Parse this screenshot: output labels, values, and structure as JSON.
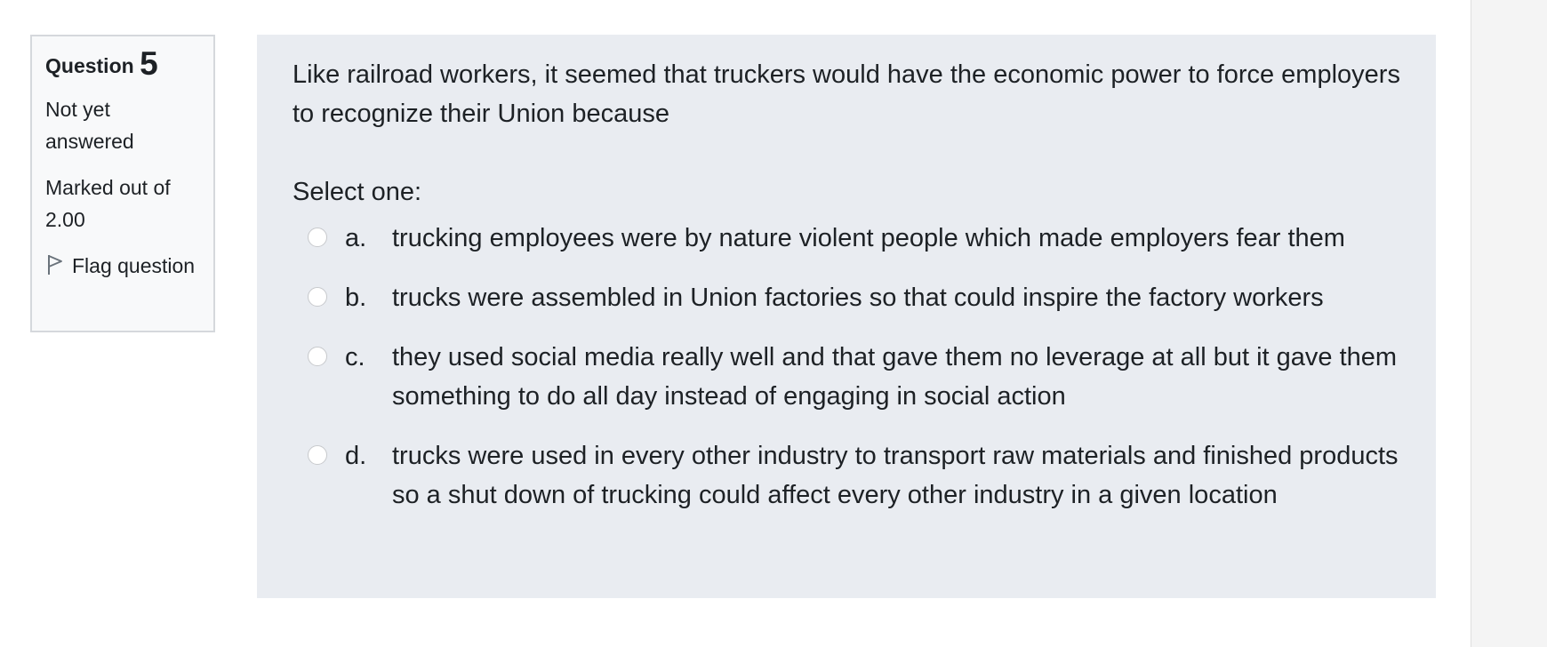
{
  "question": {
    "label": "Question",
    "number": "5",
    "status": "Not yet answered",
    "marks": "Marked out of 2.00",
    "flag_label": "Flag question",
    "text": "Like railroad workers, it seemed that truckers would have the economic power to force employers to recognize their Union because",
    "prompt": "Select one:"
  },
  "answers": [
    {
      "letter": "a.",
      "text": "trucking employees were by nature violent people which made employers fear them"
    },
    {
      "letter": "b.",
      "text": "trucks were assembled in Union factories so that could inspire the factory workers"
    },
    {
      "letter": "c.",
      "text": "they used social media really well and that gave them no leverage at all but it gave them something to do all day instead of engaging in social action"
    },
    {
      "letter": "d.",
      "text": "trucks were used in every other industry to transport raw materials and finished products so a shut down of trucking could affect every other industry in a given location"
    }
  ],
  "icons": {
    "flag": "flag-outline-icon",
    "radio": "radio-unchecked-icon"
  },
  "colors": {
    "content_bg": "#e9ecf1",
    "info_bg": "#f8f9fa",
    "info_border": "#d5d8dc",
    "text": "#1d2125"
  }
}
